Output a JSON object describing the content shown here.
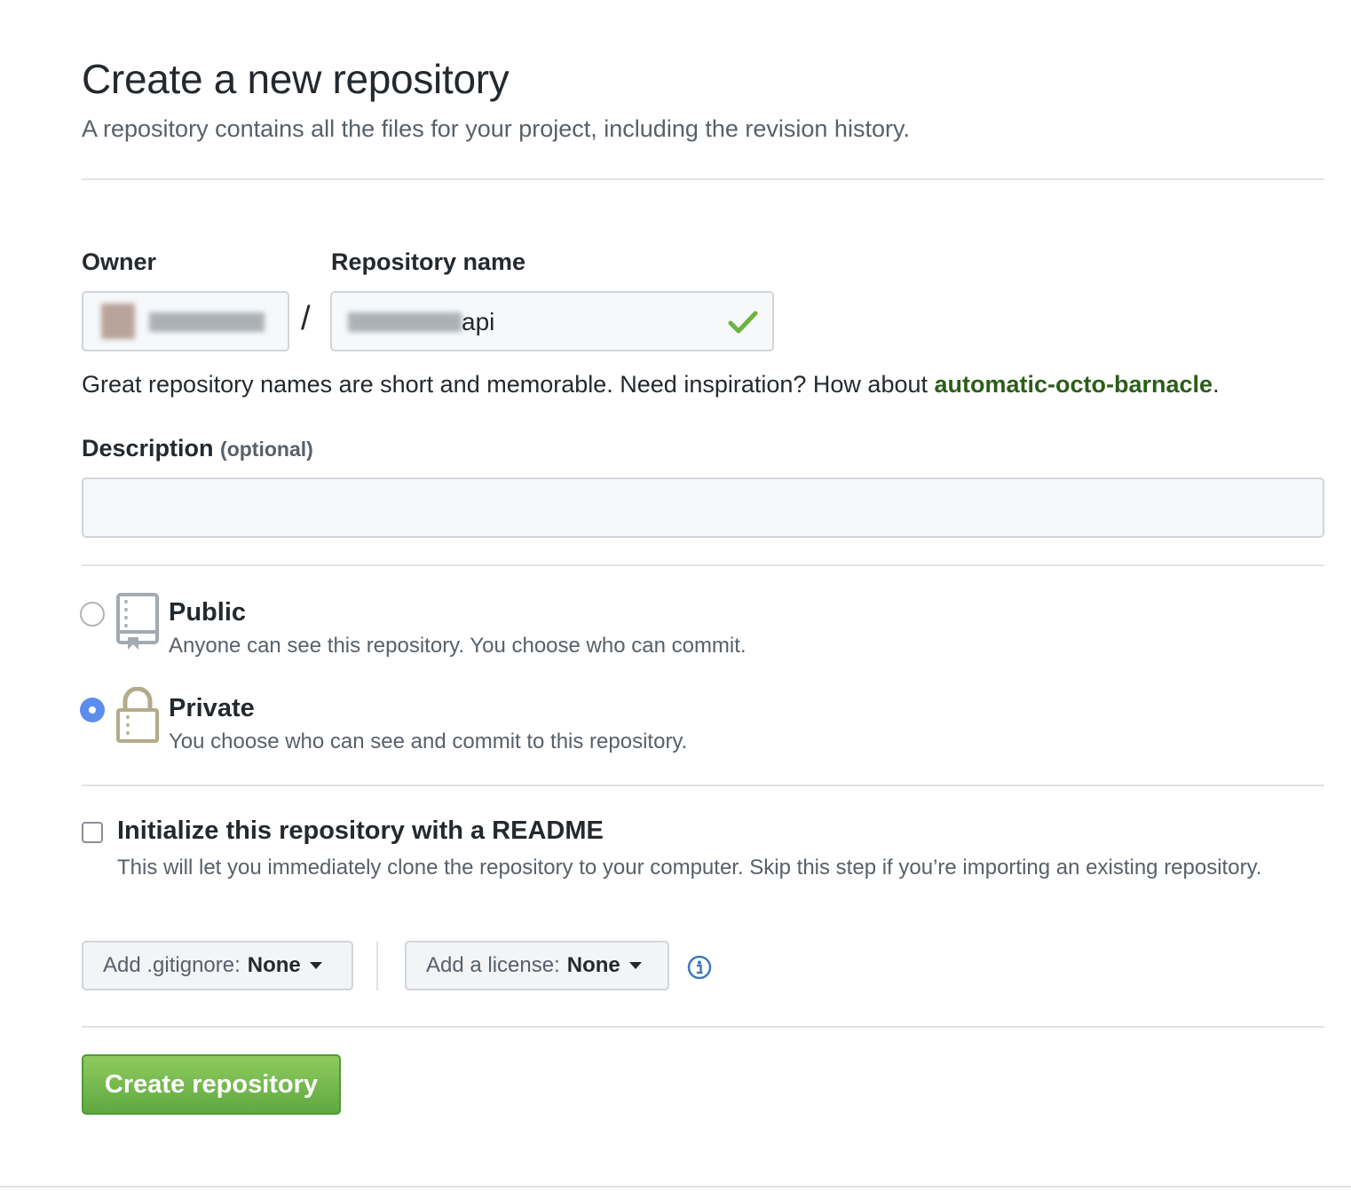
{
  "header": {
    "title": "Create a new repository",
    "subtitle": "A repository contains all the files for your project, including the revision history."
  },
  "owner": {
    "label": "Owner"
  },
  "repo_name": {
    "label": "Repository name",
    "value_visible": "api",
    "separator": "/",
    "valid_icon": "check-icon"
  },
  "hint": {
    "text": "Great repository names are short and memorable. Need inspiration? How about ",
    "suggestion": "automatic-octo-barnacle",
    "end": "."
  },
  "description": {
    "label": "Description",
    "optional": "(optional)",
    "value": ""
  },
  "visibility": {
    "selected": "Private",
    "options": [
      {
        "title": "Public",
        "desc": "Anyone can see this repository. You choose who can commit.",
        "icon": "repo-book-icon"
      },
      {
        "title": "Private",
        "desc": "You choose who can see and commit to this repository.",
        "icon": "lock-icon"
      }
    ]
  },
  "readme": {
    "checked": false,
    "title": "Initialize this repository with a README",
    "desc": "This will let you immediately clone the repository to your computer. Skip this step if you’re importing an existing repository."
  },
  "gitignore": {
    "label": "Add .gitignore:",
    "value": "None"
  },
  "license": {
    "label": "Add a license:",
    "value": "None",
    "info_icon": "info-icon"
  },
  "submit": {
    "label": "Create repository"
  },
  "colors": {
    "accent_green": "#5fa842",
    "suggestion_green": "#2c5d1a",
    "radio_blue": "#5b8def",
    "lock_tan": "#b3ab8a"
  }
}
